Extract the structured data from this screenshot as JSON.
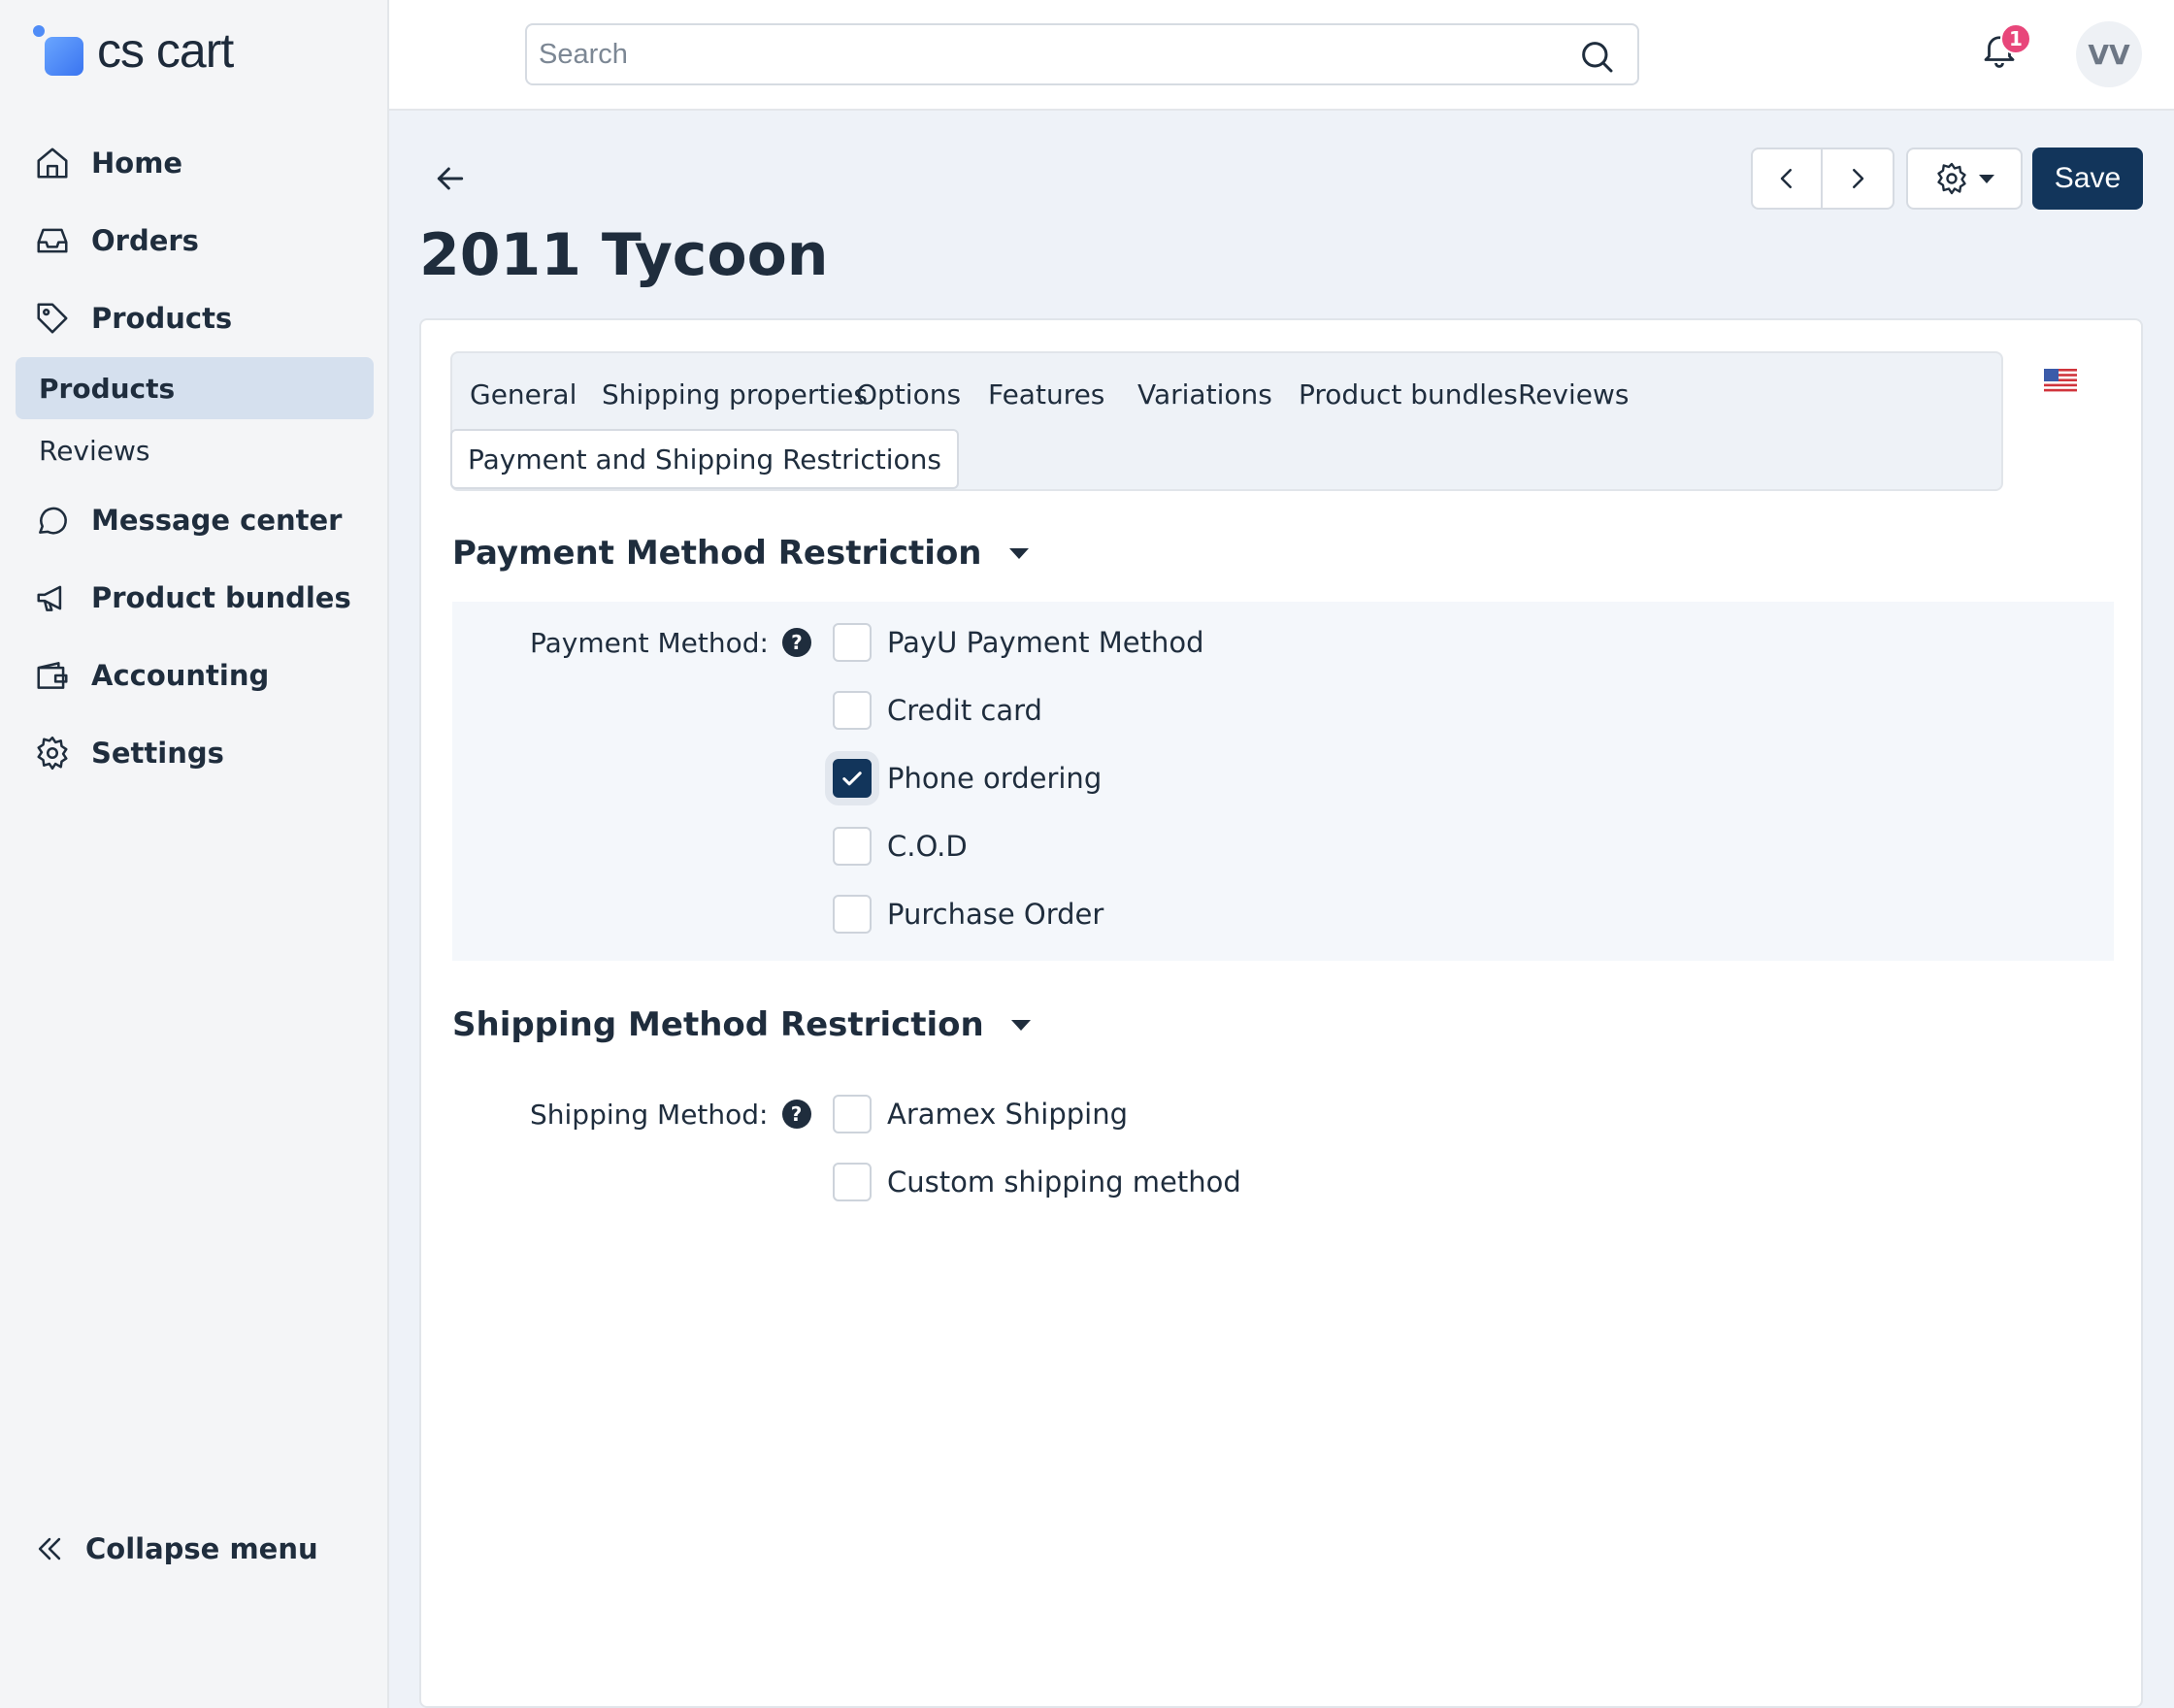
{
  "app": {
    "logo_text": "cs cart"
  },
  "sidebar": {
    "items": [
      {
        "label": "Home",
        "icon": "home-icon"
      },
      {
        "label": "Orders",
        "icon": "inbox-icon"
      },
      {
        "label": "Products",
        "icon": "tag-icon"
      },
      {
        "label": "Message center",
        "icon": "chat-icon"
      },
      {
        "label": "Product bundles",
        "icon": "megaphone-icon"
      },
      {
        "label": "Accounting",
        "icon": "wallet-icon"
      },
      {
        "label": "Settings",
        "icon": "gear-icon"
      }
    ],
    "sub_items": [
      {
        "label": "Products",
        "active": true
      },
      {
        "label": "Reviews",
        "active": false
      }
    ],
    "collapse_label": "Collapse menu"
  },
  "topbar": {
    "search_placeholder": "Search",
    "notification_count": "1",
    "avatar_initials": "VV"
  },
  "toolbar": {
    "save_label": "Save"
  },
  "page": {
    "title": "2011 Tycoon"
  },
  "tabs": [
    {
      "label": "General",
      "active": false
    },
    {
      "label": "Shipping properties",
      "active": false
    },
    {
      "label": "Options",
      "active": false
    },
    {
      "label": "Features",
      "active": false
    },
    {
      "label": "Variations",
      "active": false
    },
    {
      "label": "Product bundles",
      "active": false
    },
    {
      "label": "Reviews",
      "active": false
    },
    {
      "label": "Payment and Shipping Restrictions",
      "active": true
    }
  ],
  "payment_section": {
    "title": "Payment Method Restriction",
    "field_label": "Payment Method:",
    "options": [
      {
        "label": "PayU Payment Method",
        "checked": false
      },
      {
        "label": "Credit card",
        "checked": false
      },
      {
        "label": "Phone ordering",
        "checked": true
      },
      {
        "label": "C.O.D",
        "checked": false
      },
      {
        "label": "Purchase Order",
        "checked": false
      }
    ]
  },
  "shipping_section": {
    "title": "Shipping Method Restriction",
    "field_label": "Shipping Method:",
    "options": [
      {
        "label": "Aramex Shipping",
        "checked": false
      },
      {
        "label": "Custom shipping method",
        "checked": false
      }
    ]
  },
  "colors": {
    "primary": "#12355b",
    "badge": "#e8467a",
    "active_nav_bg": "#d5e0ee",
    "page_bg": "#eef2f8"
  }
}
